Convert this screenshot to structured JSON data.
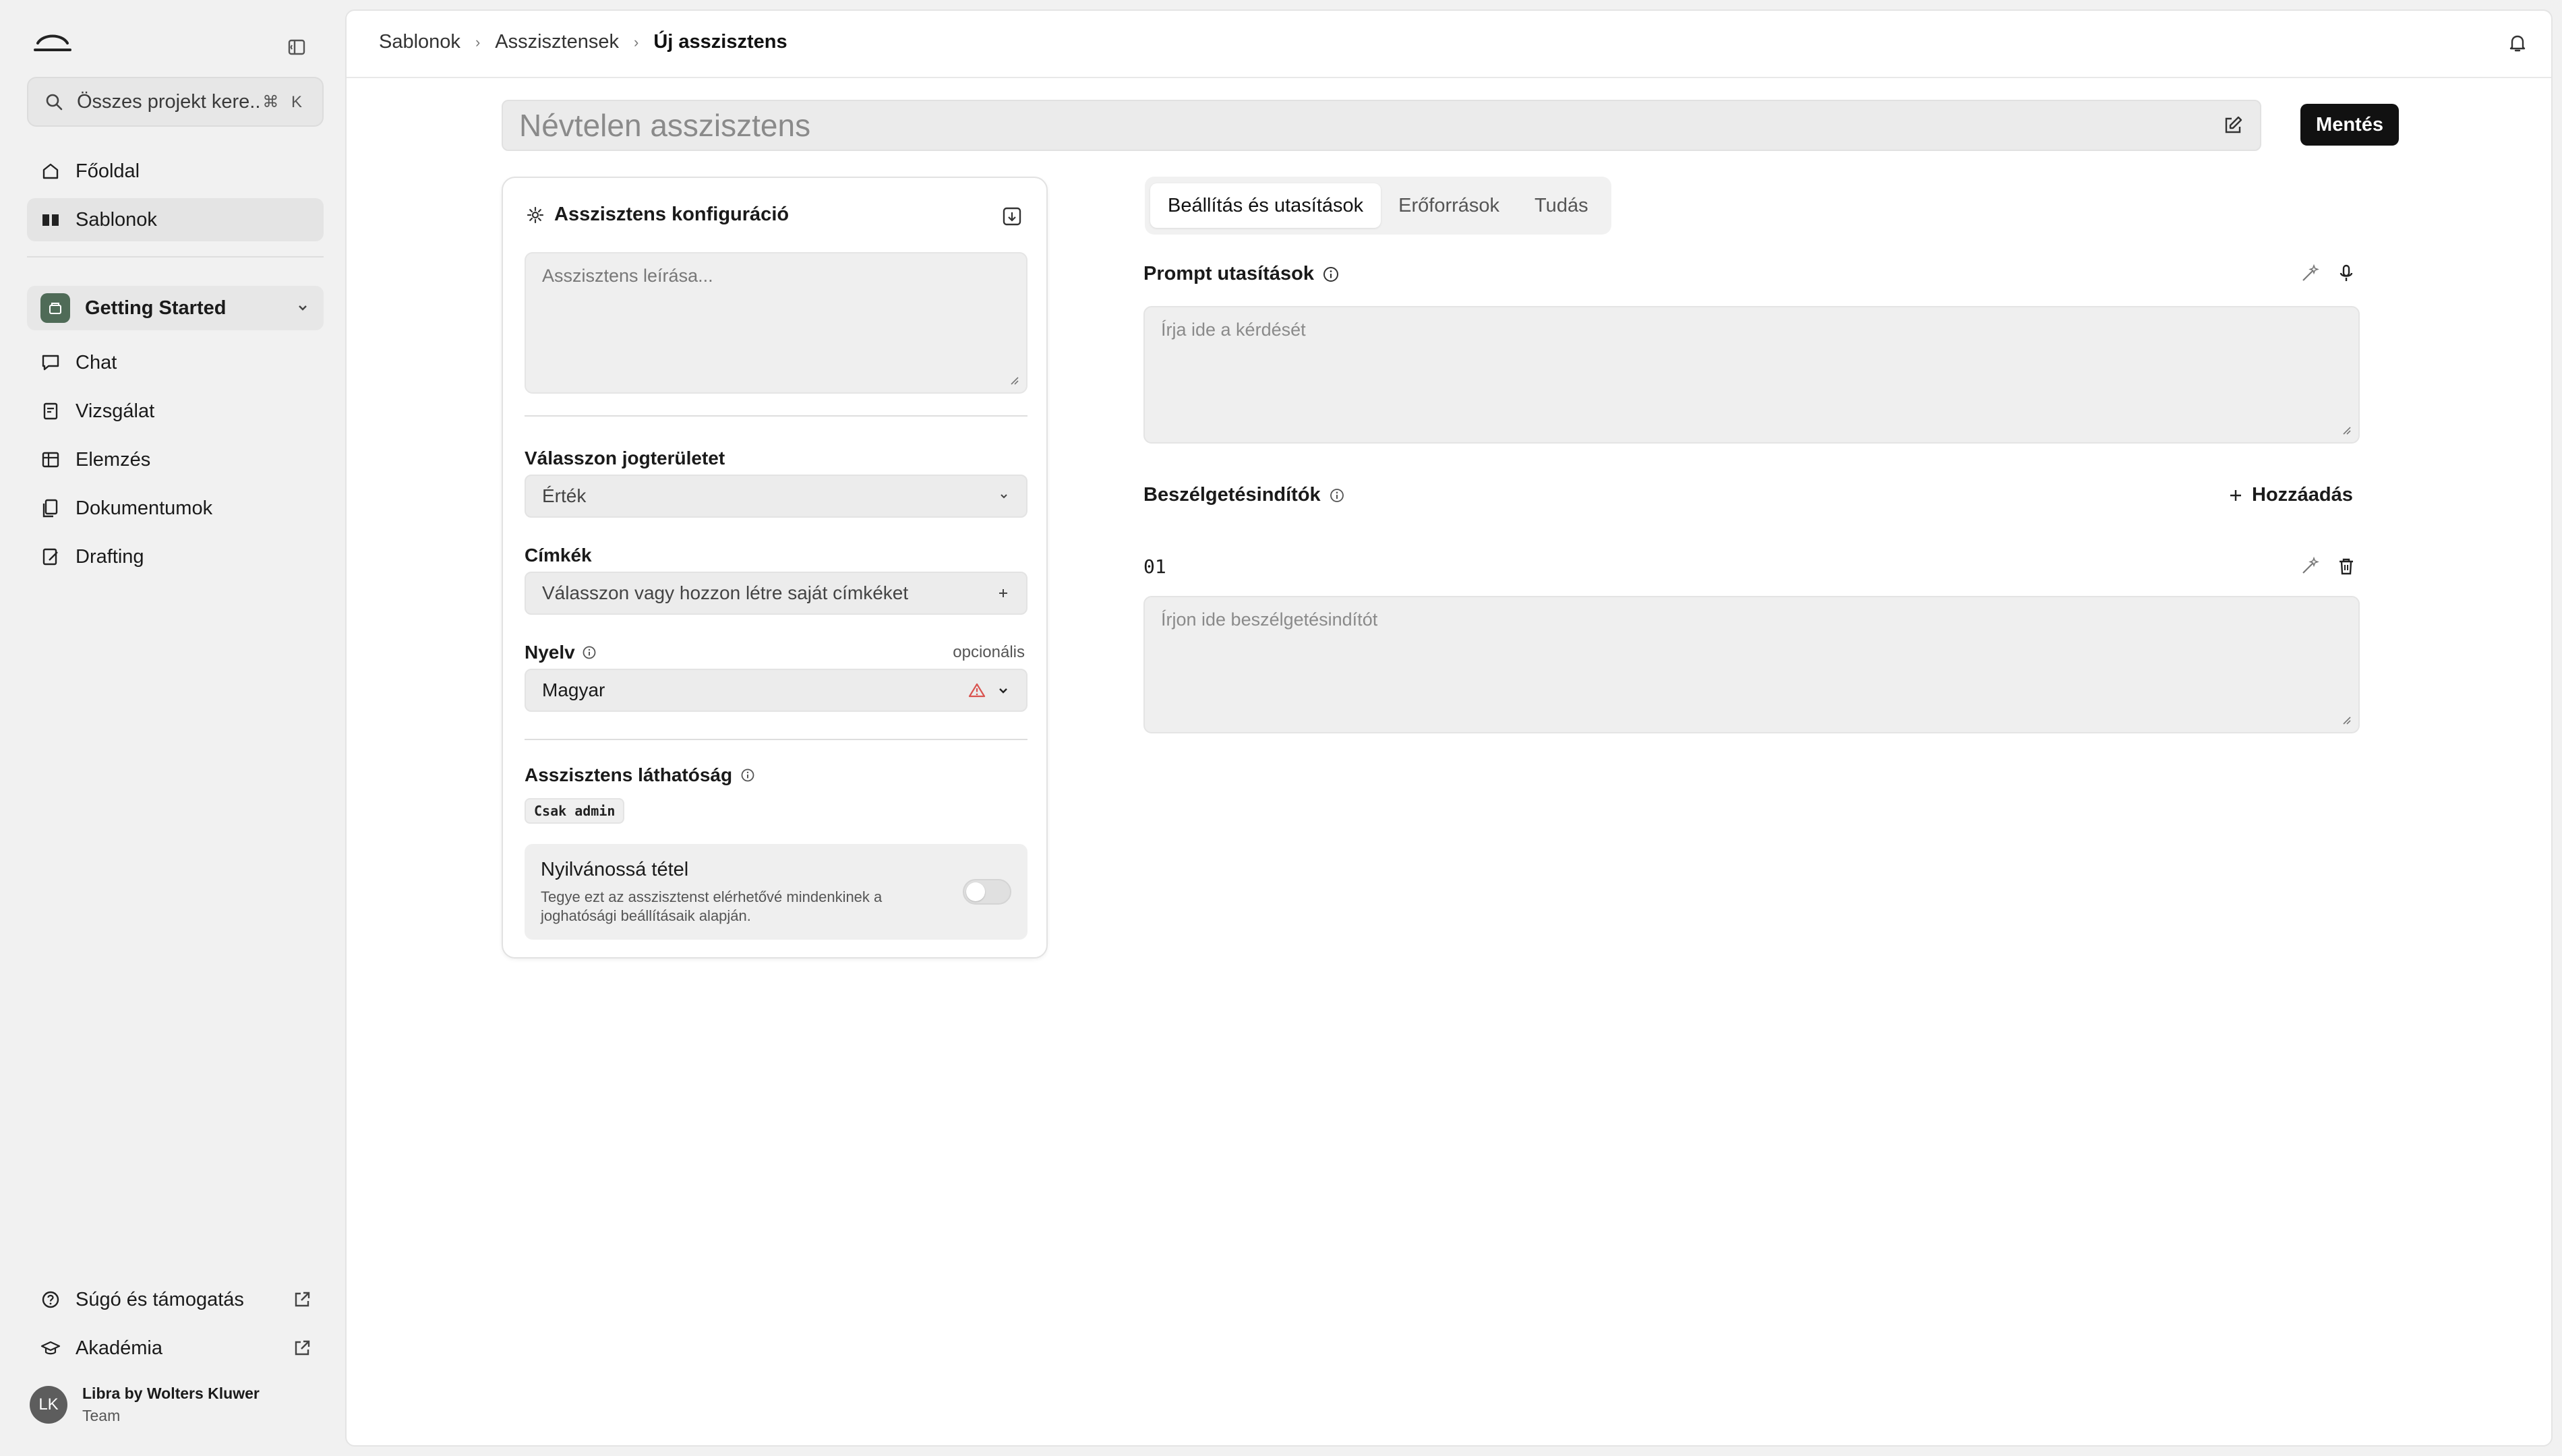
{
  "sidebar": {
    "search": {
      "placeholder": "Összes projekt kere...",
      "shortcut": "⌘ K"
    },
    "nav": [
      {
        "label": "Főoldal",
        "icon": "home-icon"
      },
      {
        "label": "Sablonok",
        "icon": "book-icon",
        "active": true
      }
    ],
    "project": {
      "label": "Getting Started",
      "color": "#4f6b57"
    },
    "project_nav": [
      {
        "label": "Chat",
        "icon": "chat-icon"
      },
      {
        "label": "Vizsgálat",
        "icon": "review-icon"
      },
      {
        "label": "Elemzés",
        "icon": "table-icon"
      },
      {
        "label": "Dokumentumok",
        "icon": "documents-icon"
      },
      {
        "label": "Drafting",
        "icon": "drafting-icon"
      }
    ],
    "footer_nav": [
      {
        "label": "Súgó és támogatás",
        "icon": "help-icon"
      },
      {
        "label": "Akadémia",
        "icon": "graduation-cap-icon"
      }
    ],
    "user": {
      "initials": "LK",
      "name": "Libra by Wolters Kluwer",
      "team": "Team"
    }
  },
  "breadcrumb": {
    "items": [
      "Sablonok",
      "Asszisztensek"
    ],
    "current": "Új asszisztens"
  },
  "title": {
    "placeholder": "Névtelen asszisztens"
  },
  "save_label": "Mentés",
  "config": {
    "heading": "Asszisztens konfiguráció",
    "description_placeholder": "Asszisztens leírása...",
    "jurisdiction": {
      "label": "Válasszon jogterületet",
      "value": "Érték"
    },
    "tags": {
      "label": "Címkék",
      "placeholder": "Válasszon vagy hozzon létre saját címkéket"
    },
    "language": {
      "label": "Nyelv",
      "optional": "opcionális",
      "value": "Magyar",
      "warning_color": "#d9534f"
    },
    "visibility": {
      "label": "Asszisztens láthatóság",
      "badge": "Csak admin"
    },
    "public": {
      "title": "Nyilvánossá tétel",
      "description": "Tegye ezt az asszisztenst elérhetővé mindenkinek a joghatósági beállításaik alapján.",
      "enabled": false
    }
  },
  "tabs": [
    {
      "label": "Beállítás és utasítások",
      "active": true
    },
    {
      "label": "Erőforrások"
    },
    {
      "label": "Tudás"
    }
  ],
  "prompt": {
    "label": "Prompt utasítások",
    "placeholder": "Írja ide a kérdését"
  },
  "starters": {
    "label": "Beszélgetésindítók",
    "add_label": "Hozzáadás",
    "items": [
      {
        "number": "01",
        "placeholder": "Írjon ide beszélgetésindítót"
      }
    ]
  }
}
